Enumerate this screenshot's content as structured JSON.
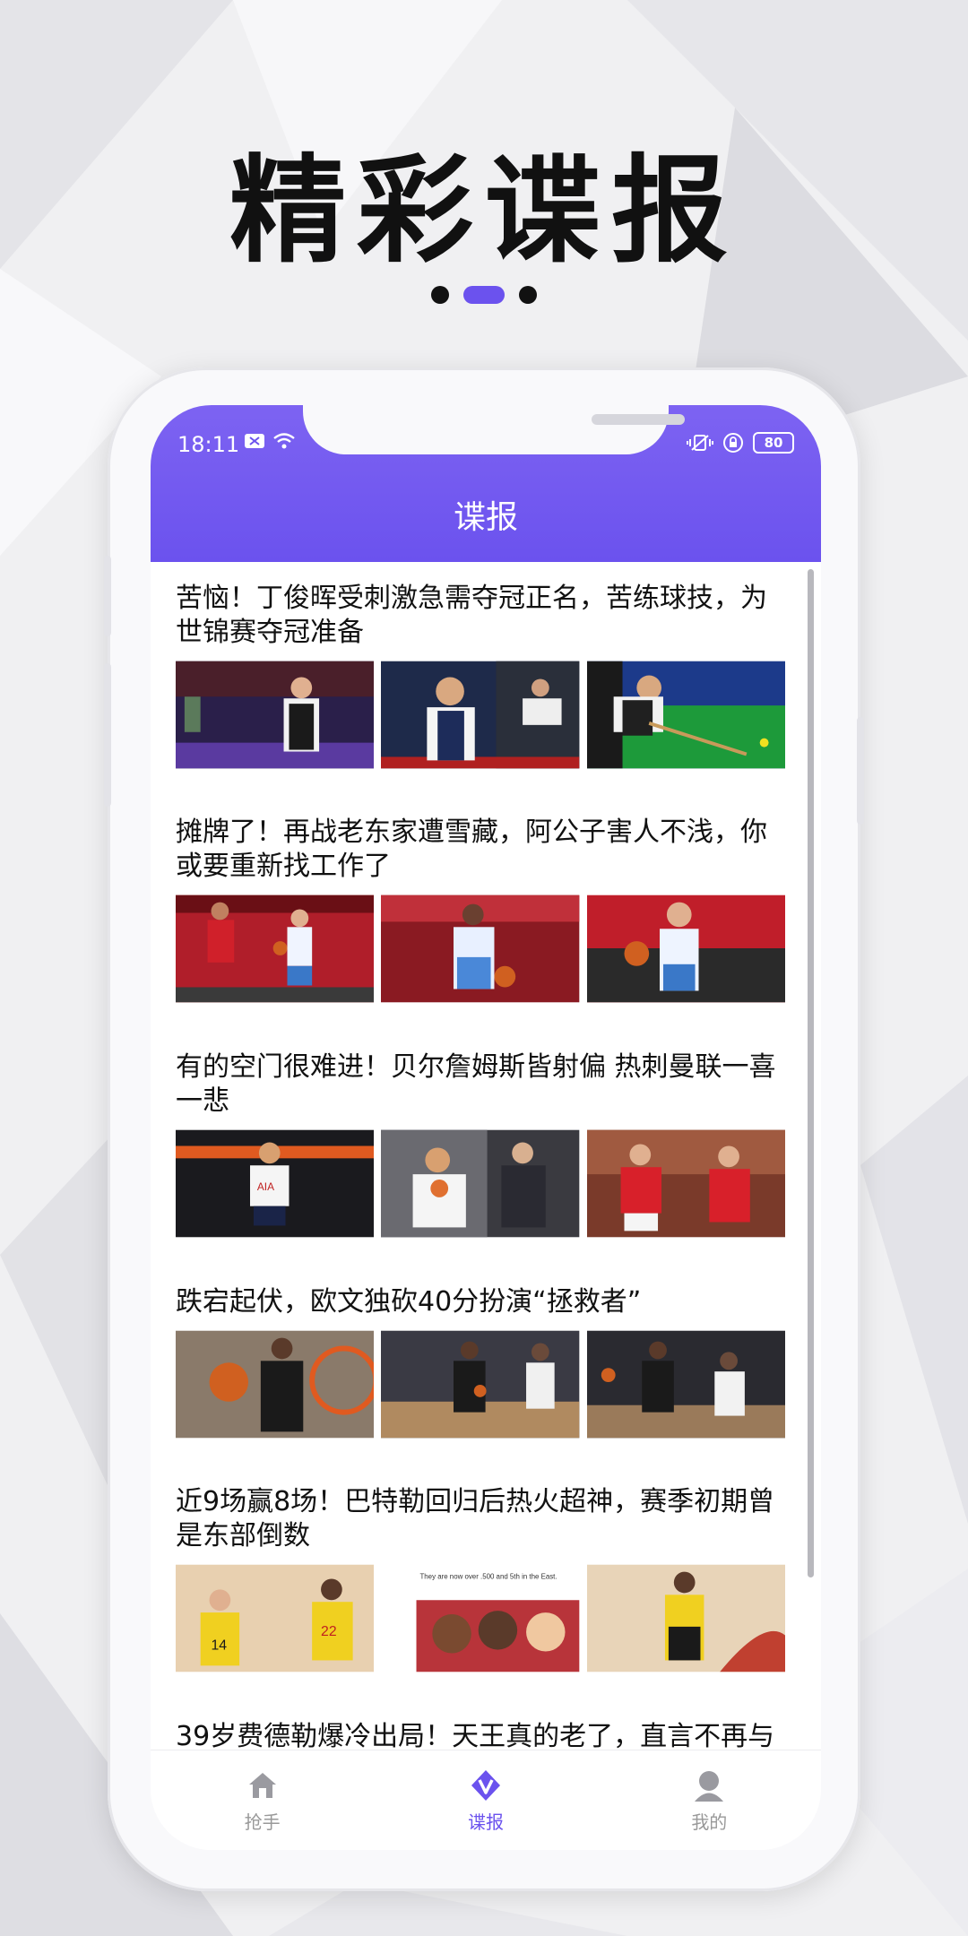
{
  "promo": {
    "title": "精彩谍报"
  },
  "status_bar": {
    "time": "18:11",
    "battery": "80"
  },
  "header": {
    "title": "谍报"
  },
  "news": [
    {
      "title": "苦恼！丁俊晖受刺激急需夺冠正名，苦练球技，为世锦赛夺冠准备"
    },
    {
      "title": "摊牌了！再战老东家遭雪藏，阿公子害人不浅，你或要重新找工作了"
    },
    {
      "title": "有的空门很难进！贝尔詹姆斯皆射偏 热刺曼联一喜一悲"
    },
    {
      "title": "跌宕起伏，欧文独砍40分扮演“拯救者”"
    },
    {
      "title": "近9场赢8场！巴特勒回归后热火超神，赛季初期曾是东部倒数"
    },
    {
      "title": "39岁费德勒爆冷出局！天王真的老了，直言不再与"
    }
  ],
  "thumb_caption": {
    "text": "They are now over .500 and 5th in the East."
  },
  "tabbar": {
    "tabs": [
      {
        "label": "抢手",
        "icon": "home-icon"
      },
      {
        "label": "谍报",
        "icon": "v-badge-icon"
      },
      {
        "label": "我的",
        "icon": "user-icon"
      }
    ],
    "active_color": "#6b52ee",
    "inactive_color": "#999999"
  },
  "colors": {
    "accent": "#6b52ee",
    "header_gradient_top": "#7d63f2"
  }
}
